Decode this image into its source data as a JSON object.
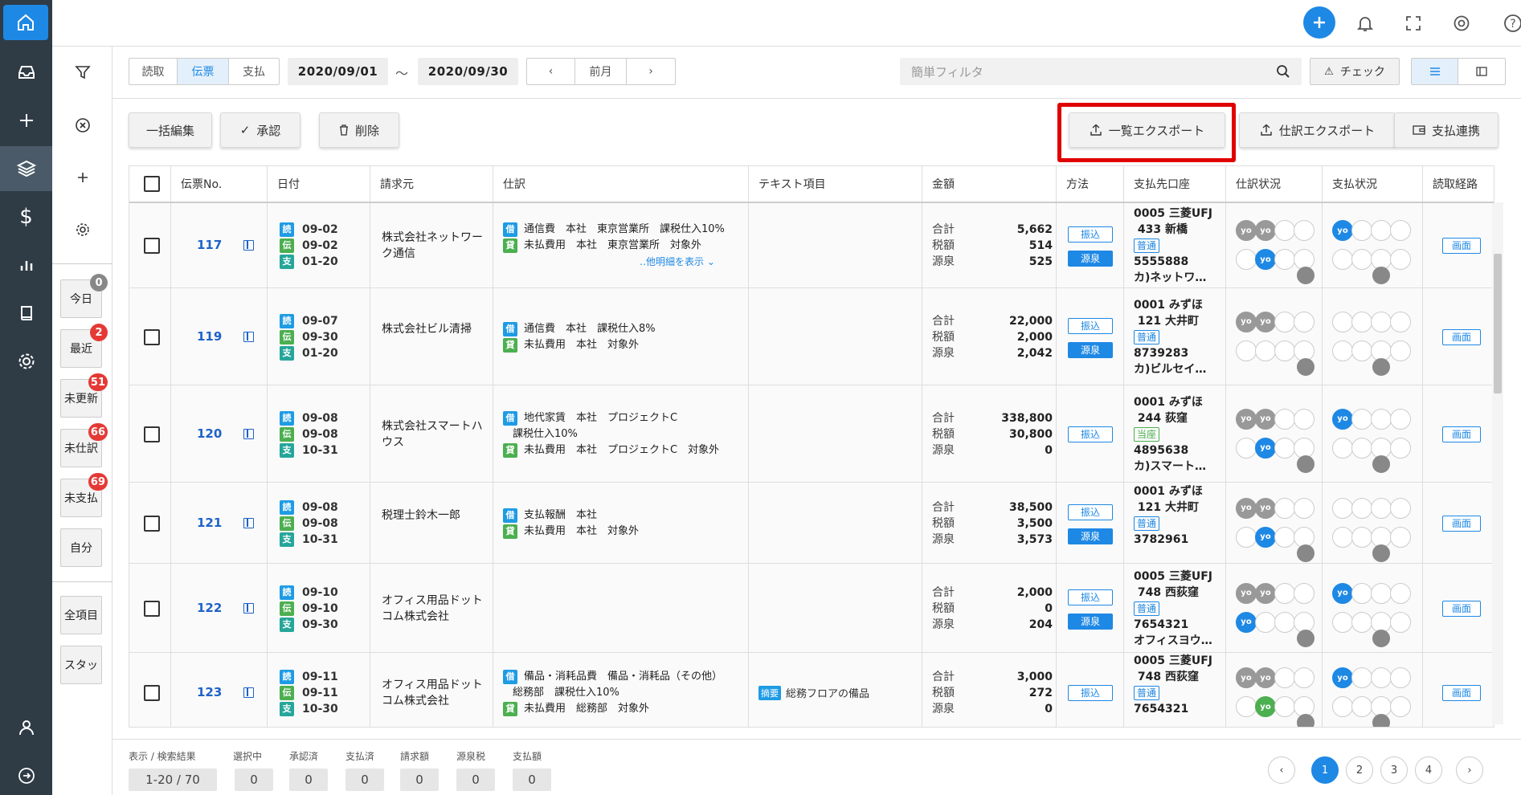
{
  "header": {
    "icons": [
      "plus-icon",
      "bell-icon",
      "fullscreen-icon",
      "help-ring-icon",
      "question-icon"
    ]
  },
  "filter_col": {
    "chips": [
      {
        "label": "今日",
        "badge": "0",
        "badge_color": "grey"
      },
      {
        "label": "最近",
        "badge": "2"
      },
      {
        "label": "未更新",
        "badge": "51"
      },
      {
        "label": "未仕訳",
        "badge": "66"
      },
      {
        "label": "未支払",
        "badge": "69"
      },
      {
        "label": "自分",
        "badge": ""
      },
      {
        "label": "全項目",
        "badge": ""
      },
      {
        "label": "スタッ",
        "badge": ""
      }
    ]
  },
  "toolbar": {
    "seg": [
      "読取",
      "伝票",
      "支払"
    ],
    "date_from": "2020/09/01",
    "tilde": "〜",
    "date_to": "2020/09/30",
    "prev_month": "前月",
    "search_placeholder": "簡単フィルタ",
    "check": "チェック",
    "bulk_edit": "一括編集",
    "approve": "承認",
    "delete": "削除",
    "list_export": "一覧エクスポート",
    "journal_export": "仕訳エクスポート",
    "payment_link": "支払連携"
  },
  "columns": [
    "伝票No.",
    "日付",
    "請求元",
    "仕訳",
    "テキスト項目",
    "金額",
    "方法",
    "支払先口座",
    "仕訳状況",
    "支払状況",
    "読取経路"
  ],
  "tags": {
    "yomi": "読",
    "den": "伝",
    "shi": "支",
    "debit": "借",
    "credit": "貸",
    "summary": "摘要"
  },
  "amount_labels": [
    "合計",
    "税額",
    "源泉"
  ],
  "methods": {
    "transfer": "振込",
    "withhold": "源泉"
  },
  "yo": "yo",
  "screen": "画面",
  "more_detail": "‥他明細を表示",
  "rows": [
    {
      "no": "117",
      "dates": [
        "09-02",
        "09-02",
        "01-20"
      ],
      "vendor": "株式会社ネットワーク通信",
      "j": [
        [
          "借",
          "通信費　本社　東京営業所　課税仕入10%"
        ],
        [
          "貸",
          "未払費用　本社　東京営業所　対象外"
        ]
      ],
      "more": true,
      "text": "",
      "amt": [
        "5,662",
        "514",
        "525"
      ],
      "withhold": true,
      "bank": [
        "0005 三菱UFJ",
        "433 新橋"
      ],
      "btype": "普通",
      "acct": [
        "5555888",
        "カ)ネットワ…"
      ],
      "pay_yo": true
    },
    {
      "no": "119",
      "dates": [
        "09-07",
        "09-30",
        "01-20"
      ],
      "vendor": "株式会社ビル清掃",
      "j": [
        [
          "借",
          "通信費　本社　課税仕入8%"
        ],
        [
          "貸",
          "未払費用　本社　対象外"
        ]
      ],
      "more": false,
      "text": "",
      "amt": [
        "22,000",
        "2,000",
        "2,042"
      ],
      "withhold": true,
      "bank": [
        "0001 みずほ",
        "121 大井町"
      ],
      "btype": "普通",
      "acct": [
        "8739283",
        "カ)ビルセイ…"
      ],
      "pay_yo": false
    },
    {
      "no": "120",
      "dates": [
        "09-08",
        "09-08",
        "10-31"
      ],
      "vendor": "株式会社スマートハウス",
      "j": [
        [
          "借",
          "地代家賃　本社　プロジェクトC"
        ],
        [
          "",
          "課税仕入10%"
        ],
        [
          "貸",
          "未払費用　本社　プロジェクトC　対象外"
        ]
      ],
      "more": false,
      "text": "",
      "amt": [
        "338,800",
        "30,800",
        "0"
      ],
      "withhold": false,
      "bank": [
        "0001 みずほ",
        "244 荻窪"
      ],
      "btype": "当座",
      "acct": [
        "4895638",
        "カ)スマート…"
      ],
      "pay_yo": true
    },
    {
      "no": "121",
      "dates": [
        "09-08",
        "09-08",
        "10-31"
      ],
      "vendor": "税理士鈴木一郎",
      "j": [
        [
          "借",
          "支払報酬　本社"
        ],
        [
          "貸",
          "未払費用　本社　対象外"
        ]
      ],
      "more": false,
      "text": "",
      "amt": [
        "38,500",
        "3,500",
        "3,573"
      ],
      "withhold": true,
      "bank": [
        "0001 みずほ",
        "121 大井町"
      ],
      "btype": "普通",
      "acct": [
        "3782961",
        ""
      ],
      "pay_yo": false
    },
    {
      "no": "122",
      "dates": [
        "09-10",
        "09-10",
        "09-30"
      ],
      "vendor": "オフィス用品ドットコム株式会社",
      "j": [],
      "more": false,
      "text": "",
      "amt": [
        "2,000",
        "0",
        "204"
      ],
      "withhold": true,
      "bank": [
        "0005 三菱UFJ",
        "748 西荻窪"
      ],
      "btype": "普通",
      "acct": [
        "7654321",
        "オフィスヨウ…"
      ],
      "pay_yo": true
    },
    {
      "no": "123",
      "dates": [
        "09-11",
        "09-11",
        "10-30"
      ],
      "vendor": "オフィス用品ドットコム株式会社",
      "j": [
        [
          "借",
          "備品・消耗品費　備品・消耗品（その他）"
        ],
        [
          "",
          "総務部　課税仕入10%"
        ],
        [
          "貸",
          "未払費用　総務部　対象外"
        ]
      ],
      "more": false,
      "text": "総務フロアの備品",
      "amt": [
        "3,000",
        "272",
        "0"
      ],
      "withhold": false,
      "bank": [
        "0005 三菱UFJ",
        "748 西荻窪"
      ],
      "btype": "普通",
      "acct": [
        "7654321",
        ""
      ],
      "pay_yo": true
    }
  ],
  "footer": {
    "labels": [
      "表示 / 検索結果",
      "選択中",
      "承認済",
      "支払済",
      "請求額",
      "源泉税",
      "支払額"
    ],
    "values": [
      "1-20 / 70",
      "0",
      "0",
      "0",
      "0",
      "0",
      "0"
    ],
    "pages": [
      "1",
      "2",
      "3",
      "4"
    ]
  }
}
